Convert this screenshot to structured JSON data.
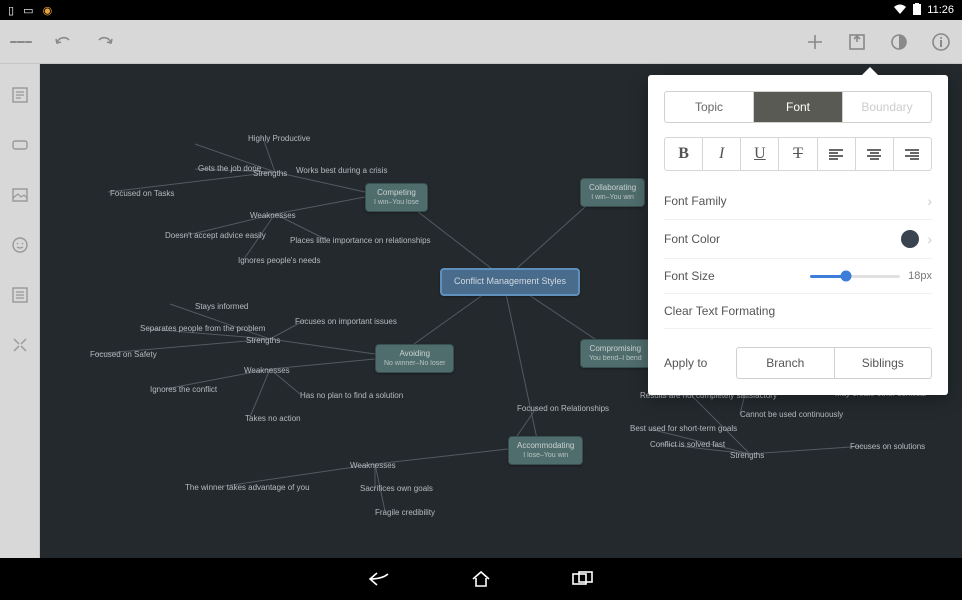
{
  "status": {
    "time": "11:26"
  },
  "canvas": {
    "central": "Conflict Management Styles",
    "cards": {
      "competing": {
        "title": "Competing",
        "sub": "I win–You lose"
      },
      "collaborating": {
        "title": "Collaborating",
        "sub": "I win–You win"
      },
      "avoiding": {
        "title": "Avoiding",
        "sub": "No winner–No loser"
      },
      "compromising": {
        "title": "Compromising",
        "sub": "You bend–I bend"
      },
      "accommodating": {
        "title": "Accommodating",
        "sub": "I lose–You win"
      }
    },
    "labels": {
      "strengths1": "Strengths",
      "weaknesses1": "Weaknesses",
      "strengths2": "Strengths",
      "weaknesses2": "Weaknesses",
      "weaknesses3": "Weaknesses",
      "strengths3": "Strengths",
      "highly_productive": "Highly Productive",
      "gets_job_done": "Gets the job done",
      "works_best_crisis": "Works best during a crisis",
      "focused_tasks": "Focused on Tasks",
      "doesnt_accept": "Doesn't accept advice easily",
      "places_little": "Places little importance on relationships",
      "ignores_needs": "Ignores people's needs",
      "stays_informed": "Stays informed",
      "separates_people": "Separates people from the problem",
      "focused_safety": "Focused on Safety",
      "ignores_conflict": "Ignores the conflict",
      "takes_no_action": "Takes no action",
      "focuses_issues": "Focuses on important issues",
      "no_plan": "Has no plan to find a solution",
      "focused_rel": "Focused on Relationships",
      "winner_takes": "The winner takes advantage of you",
      "sacrifices_goals": "Sacrifices own goals",
      "fragile_cred": "Fragile credibility",
      "results_unsat": "Results are not completely satisfactory",
      "best_shortterm": "Best used for short-term goals",
      "conflict_solved": "Conflict is solved fast",
      "focuses_solutions": "Focuses on solutions",
      "may_create": "May create other conflicts",
      "cannot_continuous": "Cannot be used continuously"
    }
  },
  "popover": {
    "tabs": {
      "topic": "Topic",
      "font": "Font",
      "boundary": "Boundary"
    },
    "font_family": "Font Family",
    "font_color": "Font Color",
    "font_size": "Font Size",
    "font_size_value": "18px",
    "clear": "Clear Text Formating",
    "apply_to": "Apply to",
    "branch": "Branch",
    "siblings": "Siblings"
  }
}
